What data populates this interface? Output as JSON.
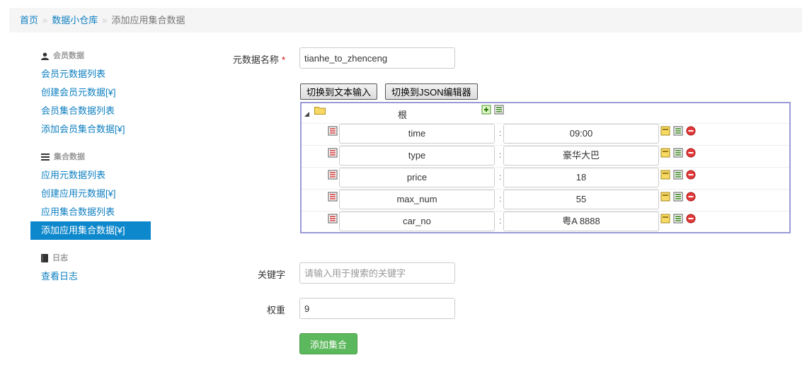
{
  "breadcrumb": {
    "home": "首页",
    "separator": "»",
    "level2": "数据小仓库",
    "current": "添加应用集合数据"
  },
  "sidebar": {
    "groups": [
      {
        "header": "会员数据",
        "icon": "user-icon",
        "items": [
          "会员元数据列表",
          "创建会员元数据[¥]",
          "会员集合数据列表",
          "添加会员集合数据[¥]"
        ]
      },
      {
        "header": "集合数据",
        "icon": "list-icon",
        "items": [
          "应用元数据列表",
          "创建应用元数据[¥]",
          "应用集合数据列表",
          "添加应用集合数据[¥]"
        ]
      },
      {
        "header": "日志",
        "icon": "book-icon",
        "items": [
          "查看日志"
        ]
      }
    ],
    "active_item": "添加应用集合数据[¥]"
  },
  "form": {
    "meta_name_label": "元数据名称",
    "required_mark": "*",
    "meta_name_value": "tianhe_to_zhenceng",
    "switch_text_button": "切换到文本输入",
    "switch_json_button": "切换到JSON编辑器",
    "editor": {
      "root_label": "根",
      "rows": [
        {
          "key": "time",
          "value": "09:00"
        },
        {
          "key": "type",
          "value": "豪华大巴"
        },
        {
          "key": "price",
          "value": "18"
        },
        {
          "key": "max_num",
          "value": "55"
        },
        {
          "key": "car_no",
          "value": "粤A 8888"
        }
      ],
      "separator": ":"
    },
    "keyword_label": "关键字",
    "keyword_placeholder": "请输入用于搜索的关键字",
    "weight_label": "权重",
    "weight_value": "9",
    "submit_button": "添加集合"
  },
  "colors": {
    "link": "#0e7fc0",
    "active_bg": "#0e88cc",
    "submit_bg": "#5cb85c",
    "required": "#cc0000",
    "editor_border": "#9a9ad8"
  }
}
